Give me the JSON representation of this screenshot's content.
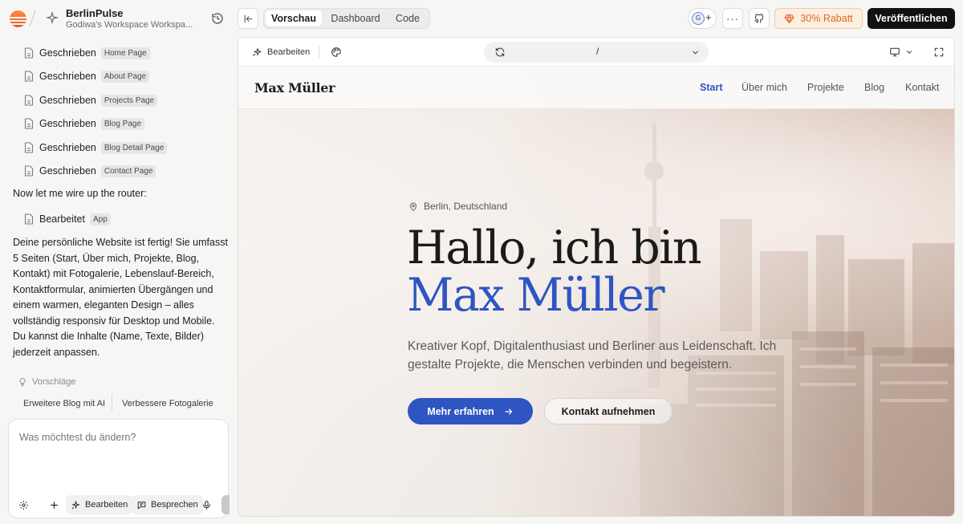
{
  "project": {
    "name": "BerlinPulse",
    "workspace": "Godiwa's Workspace Workspa..."
  },
  "chat": {
    "files": [
      {
        "verb": "Geschrieben",
        "tag": "Home Page"
      },
      {
        "verb": "Geschrieben",
        "tag": "About Page"
      },
      {
        "verb": "Geschrieben",
        "tag": "Projects Page"
      },
      {
        "verb": "Geschrieben",
        "tag": "Blog Page"
      },
      {
        "verb": "Geschrieben",
        "tag": "Blog Detail Page"
      },
      {
        "verb": "Geschrieben",
        "tag": "Contact Page"
      }
    ],
    "router_msg": "Now let me wire up the router:",
    "edit_file": {
      "verb": "Bearbeitet",
      "tag": "App"
    },
    "final_msg": "Deine persönliche Website ist fertig! Sie umfasst 5 Seiten (Start, Über mich, Projekte, Blog, Kontakt) mit Fotogalerie, Lebenslauf-Bereich, Kontaktformular, animierten Übergängen und einem warmen, eleganten Design – alles vollständig responsiv für Desktop und Mobile. Du kannst die Inhalte (Name, Texte, Bilder) jederzeit anpassen."
  },
  "suggestions": {
    "label": "Vorschläge",
    "items": [
      "Erweitere Blog mit AI",
      "Verbessere Fotogalerie"
    ]
  },
  "composer": {
    "placeholder": "Was möchtest du ändern?",
    "edit_label": "Bearbeiten",
    "discuss_label": "Besprechen"
  },
  "topbar": {
    "tabs": [
      "Vorschau",
      "Dashboard",
      "Code"
    ],
    "active_tab": "Vorschau",
    "avatar_initial": "G",
    "avatar_plus": "+",
    "more": "···",
    "discount": "30% Rabatt",
    "publish": "Veröffentlichen"
  },
  "preview_toolbar": {
    "edit_label": "Bearbeiten",
    "path": "/"
  },
  "site": {
    "brand": "Max Müller",
    "nav": [
      "Start",
      "Über mich",
      "Projekte",
      "Blog",
      "Kontakt"
    ],
    "active_nav": "Start",
    "location": "Berlin, Deutschland",
    "headline_1": "Hallo, ich bin",
    "headline_2": "Max Müller",
    "lead": "Kreativer Kopf, Digitalenthusiast und Berliner aus Leidenschaft. Ich gestalte Projekte, die Menschen verbinden und begeistern.",
    "cta_primary": "Mehr erfahren",
    "cta_secondary": "Kontakt aufnehmen"
  },
  "colors": {
    "accent": "#2f55c3",
    "brand_orange": "#f2542d",
    "discount_text": "#e0691f",
    "publish_bg": "#111111"
  },
  "icons": {
    "logo": "logo-icon",
    "history": "history-icon",
    "file": "file-icon",
    "bulb": "lightbulb-icon",
    "settings": "settings-icon",
    "plus": "plus-icon",
    "sparkle": "sparkle-icon",
    "chat": "chat-icon",
    "mic": "mic-icon",
    "collapse": "collapse-sidebar-icon",
    "github": "github-icon",
    "gem": "gem-icon",
    "palette": "palette-icon",
    "reload": "reload-icon",
    "chevron": "chevron-down-icon",
    "monitor": "monitor-icon",
    "expand": "fullscreen-icon",
    "pin": "map-pin-icon",
    "arrow": "arrow-right-icon"
  }
}
